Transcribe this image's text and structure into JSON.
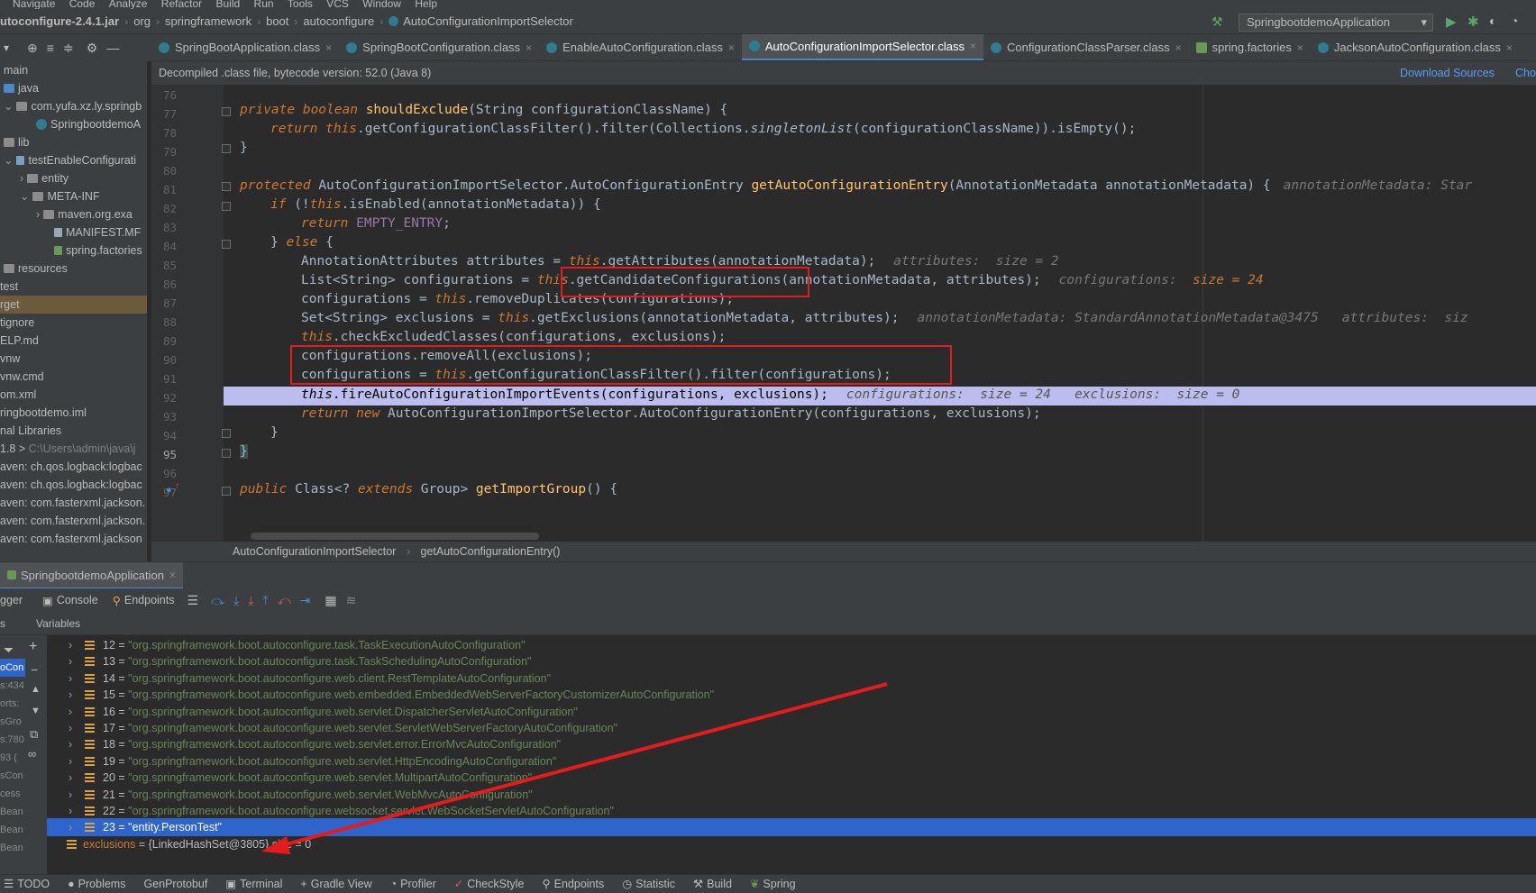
{
  "menubar": {
    "items": [
      "Navigate",
      "Code",
      "Analyze",
      "Refactor",
      "Build",
      "Run",
      "Tools",
      "VCS",
      "Window",
      "Help"
    ]
  },
  "breadcrumb": {
    "items": [
      "utoconfigure-2.4.1.jar",
      "org",
      "springframework",
      "boot",
      "autoconfigure",
      "AutoConfigurationImportSelector"
    ]
  },
  "run_config": {
    "label": "SpringbootdemoApplication"
  },
  "tabs": [
    {
      "label": "SpringBootApplication.class"
    },
    {
      "label": "SpringBootConfiguration.class"
    },
    {
      "label": "EnableAutoConfiguration.class"
    },
    {
      "label": "AutoConfigurationImportSelector.class"
    },
    {
      "label": "ConfigurationClassParser.class"
    },
    {
      "label": "spring.factories"
    },
    {
      "label": "JacksonAutoConfiguration.class"
    }
  ],
  "project_tree": [
    {
      "label": "main"
    },
    {
      "label": "java"
    },
    {
      "label": "com.yufa.xz.ly.springb"
    },
    {
      "label": "SpringbootdemoA"
    },
    {
      "label": "lib"
    },
    {
      "label": "testEnableConfigurati"
    },
    {
      "label": "entity"
    },
    {
      "label": "META-INF"
    },
    {
      "label": "maven.org.exa"
    },
    {
      "label": "MANIFEST.MF"
    },
    {
      "label": "spring.factories"
    },
    {
      "label": "resources"
    },
    {
      "label": "test"
    },
    {
      "label": "rget"
    },
    {
      "label": "tignore"
    },
    {
      "label": "ELP.md"
    },
    {
      "label": "vnw"
    },
    {
      "label": "vnw.cmd"
    },
    {
      "label": "om.xml"
    },
    {
      "label": "ringbootdemo.iml"
    },
    {
      "label": "nal Libraries"
    },
    {
      "label": "1.8 >"
    },
    {
      "label": "aven: ch.qos.logback:logbac"
    },
    {
      "label": "aven: ch.qos.logback:logbac"
    },
    {
      "label": "aven: com.fasterxml.jackson."
    },
    {
      "label": "aven: com.fasterxml.jackson."
    },
    {
      "label": "aven: com.fasterxml.jackson"
    }
  ],
  "project_tree_path": "C:\\Users\\admin\\java\\j",
  "infobar": {
    "text": "Decompiled .class file, bytecode version: 52.0 (Java 8)",
    "download": "Download Sources",
    "choose": "Cho"
  },
  "line_numbers": [
    "76",
    "77",
    "78",
    "79",
    "80",
    "81",
    "82",
    "83",
    "84",
    "85",
    "86",
    "87",
    "88",
    "89",
    "90",
    "91",
    "92",
    "93",
    "94",
    "95",
    "96",
    "97"
  ],
  "code": {
    "l77_a": "private boolean ",
    "l77_b": "shouldExclude",
    "l77_c": "(String configurationClassName) {",
    "l78_a": "return this",
    "l78_b": ".getConfigurationClassFilter().filter(Collections.",
    "l78_c": "singletonList",
    "l78_d": "(configurationClassName)).isEmpty();",
    "l79": "}",
    "l81_a": "protected ",
    "l81_b": "AutoConfigurationImportSelector.AutoConfigurationEntry ",
    "l81_c": "getAutoConfigurationEntry",
    "l81_d": "(AnnotationMetadata annotationMetadata) {",
    "l81_hint": "annotationMetadata: Star",
    "l82_a": "if ",
    "l82_b": "(!",
    "l82_c": "this",
    "l82_d": ".isEnabled(annotationMetadata)) {",
    "l83_a": "return ",
    "l83_b": "EMPTY_ENTRY",
    "l83_c": ";",
    "l84_a": "} ",
    "l84_b": "else ",
    "l84_c": "{",
    "l85_a": "AnnotationAttributes attributes = ",
    "l85_b": "this",
    "l85_c": ".getAttributes(annotationMetadata);",
    "l85_hint": "attributes:  size = 2",
    "l86_a": "List<String> configurations = ",
    "l86_b": "this",
    "l86_c": ".getCandidateConfigurations(annotationMetadata, attributes);",
    "l86_hint": "configurations:  ",
    "l86_hintv": "size = 24",
    "l87_a": "configurations = ",
    "l87_b": "this",
    "l87_c": ".removeDuplicates(configurations);",
    "l88_a": "Set<String> exclusions = ",
    "l88_b": "this",
    "l88_c": ".getExclusions(annotationMetadata, attributes);",
    "l88_hint": "annotationMetadata: StandardAnnotationMetadata@3475   attributes:  siz",
    "l89_a": "this",
    "l89_b": ".checkExcludedClasses(configurations, exclusions);",
    "l90": "configurations.removeAll(exclusions);",
    "l91_a": "configurations = ",
    "l91_b": "this",
    "l91_c": ".getConfigurationClassFilter().filter(configurations);",
    "l92_a": "this",
    "l92_b": ".fireAutoConfigurationImportEvents(configurations, exclusions);",
    "l92_hint": "configurations:  size = 24   exclusions:  size = 0",
    "l93_a": "return new ",
    "l93_b": "AutoConfigurationImportSelector.AutoConfigurationEntry(configurations, exclusions);",
    "l94": "}",
    "l95": "}",
    "l97_a": "public ",
    "l97_b": "Class<? ",
    "l97_c": "extends ",
    "l97_d": "Group> ",
    "l97_e": "getImportGroup",
    "l97_f": "() {"
  },
  "editor_breadcrumb": {
    "cls": "AutoConfigurationImportSelector",
    "method": "getAutoConfigurationEntry()"
  },
  "run_tab": {
    "label": "SpringbootdemoApplication"
  },
  "debug_toolbar": {
    "debugger": "gger",
    "console": "Console",
    "endpoints": "Endpoints"
  },
  "variables_header": {
    "label": "Variables",
    "left": "s"
  },
  "variables": [
    {
      "index": "12",
      "value": "\"org.springframework.boot.autoconfigure.task.TaskExecutionAutoConfiguration\""
    },
    {
      "index": "13",
      "value": "\"org.springframework.boot.autoconfigure.task.TaskSchedulingAutoConfiguration\""
    },
    {
      "index": "14",
      "value": "\"org.springframework.boot.autoconfigure.web.client.RestTemplateAutoConfiguration\""
    },
    {
      "index": "15",
      "value": "\"org.springframework.boot.autoconfigure.web.embedded.EmbeddedWebServerFactoryCustomizerAutoConfiguration\""
    },
    {
      "index": "16",
      "value": "\"org.springframework.boot.autoconfigure.web.servlet.DispatcherServletAutoConfiguration\""
    },
    {
      "index": "17",
      "value": "\"org.springframework.boot.autoconfigure.web.servlet.ServletWebServerFactoryAutoConfiguration\""
    },
    {
      "index": "18",
      "value": "\"org.springframework.boot.autoconfigure.web.servlet.error.ErrorMvcAutoConfiguration\""
    },
    {
      "index": "19",
      "value": "\"org.springframework.boot.autoconfigure.web.servlet.HttpEncodingAutoConfiguration\""
    },
    {
      "index": "20",
      "value": "\"org.springframework.boot.autoconfigure.web.servlet.MultipartAutoConfiguration\""
    },
    {
      "index": "21",
      "value": "\"org.springframework.boot.autoconfigure.web.servlet.WebMvcAutoConfiguration\""
    },
    {
      "index": "22",
      "value": "\"org.springframework.boot.autoconfigure.websocket.servlet.WebSocketServletAutoConfiguration\""
    },
    {
      "index": "23",
      "value": "\"entity.PersonTest\""
    }
  ],
  "exclusions_row": {
    "name": "exclusions",
    "value": " = {LinkedHashSet@3805}  size = 0"
  },
  "left_strip_labels": [
    "oCon",
    "s:434",
    "orts:",
    "sGro",
    "s:780",
    "93 (",
    "sCon",
    "cess",
    "Bean",
    "Bean",
    "Bean"
  ],
  "statusbar": {
    "items": [
      "TODO",
      "Problems",
      "GenProtobuf",
      "Terminal",
      "Gradle View",
      "Profiler",
      "CheckStyle",
      "Endpoints",
      "Statistic",
      "Build",
      "Spring"
    ]
  },
  "colors": {
    "accent": "#4a88c7",
    "annotation_red": "#e51c1c",
    "highlight": "#c9c9ff",
    "selection": "#2f65ca"
  }
}
